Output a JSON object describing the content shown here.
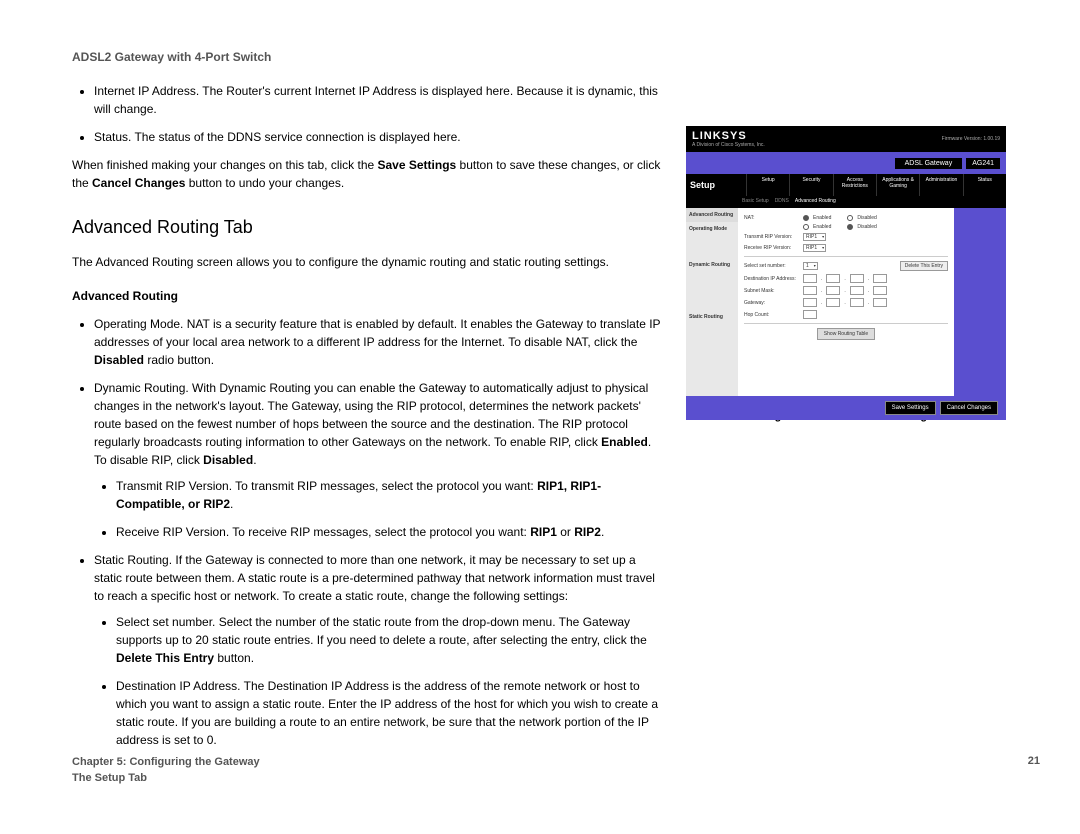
{
  "header": {
    "product": "ADSL2 Gateway with 4-Port Switch"
  },
  "intro_bullets": [
    {
      "text": "Internet IP Address. The Router's current Internet IP Address is displayed here. Because it is dynamic, this will change."
    },
    {
      "text": "Status. The status of the DDNS service connection is displayed here."
    }
  ],
  "save_para_parts": {
    "a": "When finished making your changes on this tab, click the ",
    "b": "Save Settings",
    "c": " button to save these changes, or click the ",
    "d": "Cancel Changes",
    "e": " button to undo your changes."
  },
  "section_heading": "Advanced Routing Tab",
  "section_intro": "The Advanced Routing screen allows you to configure the dynamic routing and static routing settings.",
  "subheading": "Advanced Routing",
  "adv_bullets": {
    "nat": {
      "a": "Operating Mode. NAT is a security feature that is enabled by default. It enables the Gateway to translate IP addresses of your local area network to a different IP address for the Internet. To disable NAT, click the ",
      "b": "Disabled",
      "c": " radio button."
    },
    "dynamic": {
      "a": "Dynamic Routing. With Dynamic Routing you can enable the Gateway to automatically adjust to physical changes in the network's layout. The Gateway, using the RIP protocol, determines the network packets' route based on the fewest number of hops between the source and the destination. The RIP protocol regularly broadcasts routing information to other Gateways on the network. To enable RIP, click ",
      "b": "Enabled",
      "c": ". To disable RIP, click ",
      "d": "Disabled",
      "e": "."
    },
    "tx": {
      "a": "Transmit RIP Version. To transmit RIP messages, select the protocol you want: ",
      "b": "RIP1, RIP1-Compatible, or RIP2",
      "c": "."
    },
    "rx": {
      "a": "Receive RIP Version. To receive RIP messages, select the protocol you want: ",
      "b": "RIP1",
      "c": " or ",
      "d": "RIP2",
      "e": "."
    },
    "static": {
      "a": "Static Routing. If the Gateway is connected to more than one network, it may be necessary to set up a static route between them. A static route is a pre-determined pathway that network information must travel to reach a specific host or network. To create a static route, change the following settings:"
    },
    "select_set": {
      "a": "Select set number. Select the number of the static route from the drop-down menu. The Gateway supports up to 20 static route entries. If you need to delete a route, after selecting the entry, click the ",
      "b": "Delete This Entry",
      "c": " button."
    },
    "dest_ip": {
      "a": "Destination IP Address. The Destination IP Address is the address of the remote network or host to which you want to assign a static route. Enter the IP address of the host for which you wish to create a static route. If you are building a route to an entire network, be sure that the network portion of the IP address is set to 0."
    }
  },
  "figure": {
    "brand": "LINKSYS",
    "brand_sub": "A Division of Cisco Systems, Inc.",
    "bluebar_tag": "ADSL Gateway",
    "bluebar_model": "AG241",
    "setup_label": "Setup",
    "tabs": [
      "Setup",
      "Security",
      "Access Restrictions",
      "Applications & Gaming",
      "Administration",
      "Status"
    ],
    "subnav": [
      "Basic Setup",
      "DDNS",
      "Advanced Routing"
    ],
    "side_labels": [
      "Advanced Routing",
      "Operating Mode",
      "Dynamic Routing",
      "Static Routing"
    ],
    "rows": {
      "nat_label": "NAT:",
      "enabled": "Enabled",
      "disabled": "Disabled",
      "tx_label": "Transmit RIP Version:",
      "rx_label": "Receive RIP Version:",
      "rip_opt": "RIP1",
      "select_set": "Select set number:",
      "set_opt": "1",
      "delete_btn": "Delete This Entry",
      "dest_ip": "Destination IP Address:",
      "subnet": "Subnet Mask:",
      "gateway": "Gateway:",
      "hop": "Hop Count:",
      "show_table": "Show Routing Table"
    },
    "footer_save": "Save Settings",
    "footer_cancel": "Cancel Changes",
    "fw": "Firmware Version: 1.00.19"
  },
  "figure_caption": "Figure 5-12: Advanced Routing",
  "footer": {
    "chapter": "Chapter 5: Configuring the Gateway",
    "tab": "The Setup Tab",
    "page": "21"
  }
}
